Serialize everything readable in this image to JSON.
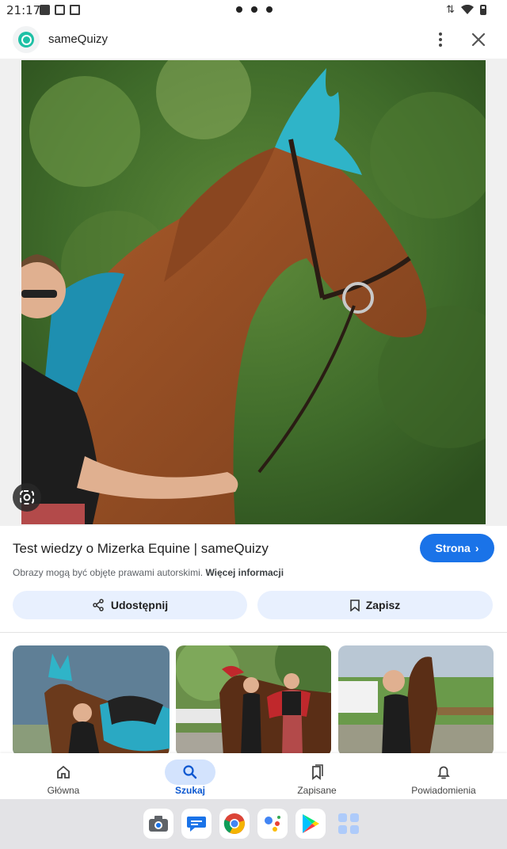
{
  "status_bar": {
    "time": "21:17"
  },
  "header": {
    "site_name": "sameQuizy"
  },
  "result": {
    "title": "Test wiedzy o Mizerka Equine | sameQuizy",
    "visit_label": "Strona",
    "copyright_text": "Obrazy mogą być objęte prawami autorskimi.",
    "more_info_label": "Więcej informacji"
  },
  "actions": {
    "share_label": "Udostępnij",
    "save_label": "Zapisz"
  },
  "bottom_nav": {
    "items": [
      {
        "label": "Główna",
        "icon": "home-icon"
      },
      {
        "label": "Szukaj",
        "icon": "search-icon",
        "active": true
      },
      {
        "label": "Zapisane",
        "icon": "bookmarks-icon"
      },
      {
        "label": "Powiadomienia",
        "icon": "bell-icon"
      }
    ]
  },
  "dock": {
    "apps": [
      "camera-app",
      "messages-app",
      "chrome-app",
      "assistant-app",
      "play-store-app",
      "apps-grid"
    ]
  },
  "colors": {
    "accent": "#1a73e8",
    "chip_bg": "#e8f0fe",
    "active_nav": "#d3e3fd"
  }
}
